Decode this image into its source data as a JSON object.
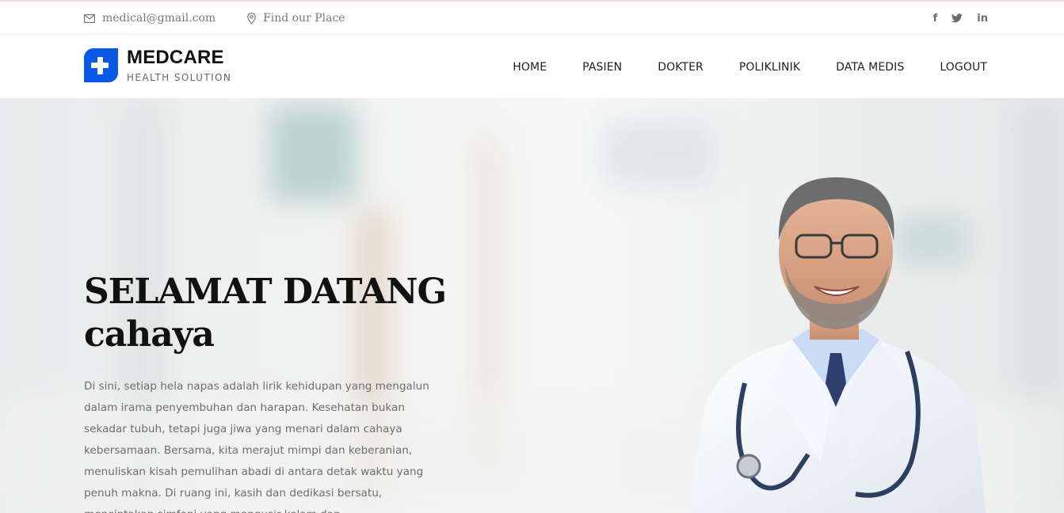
{
  "topbar": {
    "email": "medical@gmail.com",
    "place": "Find our Place",
    "socials": [
      "f",
      "t",
      "in"
    ]
  },
  "brand": {
    "title": "MEDCARE",
    "subtitle": "HEALTH SOLUTION"
  },
  "nav": {
    "items": [
      "HOME",
      "PASIEN",
      "DOKTER",
      "POLIKLINIK",
      "DATA MEDIS",
      "LOGOUT"
    ]
  },
  "hero": {
    "title_line1": "SELAMAT DATANG",
    "title_line2": "cahaya",
    "text": "Di sini, setiap hela napas adalah lirik kehidupan yang mengalun dalam irama penyembuhan dan harapan. Kesehatan bukan sekadar tubuh, tetapi juga jiwa yang menari dalam cahaya kebersamaan. Bersama, kita merajut mimpi dan keberanian, menuliskan kisah pemulihan abadi di antara detak waktu yang penuh makna. Di ruang ini, kasih dan dedikasi bersatu, menciptakan simfoni yang mengusir kelam dan"
  },
  "colors": {
    "brand_blue": "#0a58e6",
    "hero_text": "#6d6d6d"
  }
}
